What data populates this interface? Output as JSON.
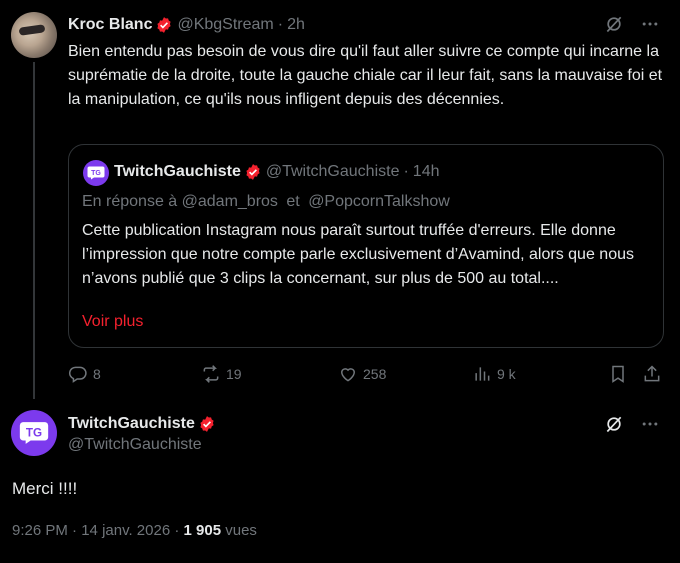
{
  "original_tweet": {
    "author_name": "Kroc Blanc",
    "author_handle": "@KbgStream",
    "separator": "·",
    "time": "2h",
    "text": "Bien entendu pas besoin de vous dire qu'il faut aller suivre ce compte qui incarne la suprématie de la droite, toute la gauche chiale car il leur fait, sans la mauvaise foi et la manipulation, ce qu'ils nous infligent depuis des décennies."
  },
  "quoted_tweet": {
    "author_name": "TwitchGauchiste",
    "author_handle": "@TwitchGauchiste",
    "separator": "·",
    "time": "14h",
    "avatar_text": "TG",
    "reply_prefix": "En réponse à",
    "reply_mention_1": "@adam_bros",
    "reply_and": "et",
    "reply_mention_2": "@PopcornTalkshow",
    "text": "Cette publication Instagram nous paraît surtout truffée d'erreurs. Elle donne l’impression que notre compte parle exclusivement d’Avamind, alors que nous n’avons publié que 3 clips la concernant, sur plus de 500 au total....",
    "see_more": "Voir plus"
  },
  "actions": {
    "replies": "8",
    "reposts": "19",
    "likes": "258",
    "views": "9 k"
  },
  "reply_tweet": {
    "author_name": "TwitchGauchiste",
    "author_handle": "@TwitchGauchiste",
    "avatar_text": "TG",
    "text": "Merci !!!!",
    "time": "9:26 PM",
    "date": "14 janv. 2026",
    "views_count": "1 905",
    "views_label": "vues",
    "separator": "·"
  },
  "colors": {
    "background": "#000000",
    "text": "#e7e9ea",
    "muted": "#71767b",
    "border": "#2f3336",
    "verified_badge": "#f4212e",
    "link": "#f4212e",
    "avatar_purple": "#7c3aed"
  },
  "icons": [
    "verified-badge-icon",
    "grok-icon",
    "more-icon",
    "reply-icon",
    "repost-icon",
    "like-icon",
    "views-icon",
    "bookmark-icon",
    "share-icon"
  ]
}
